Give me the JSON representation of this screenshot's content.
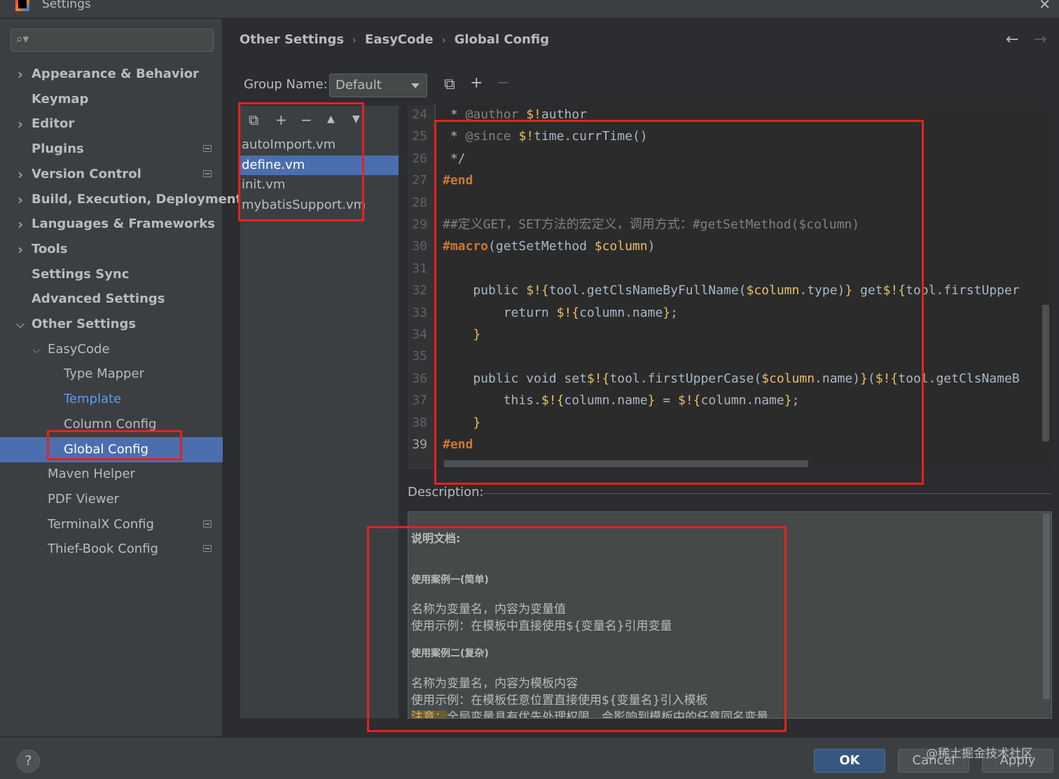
{
  "window": {
    "title": "Settings"
  },
  "search": {
    "placeholder": ""
  },
  "sidebar": {
    "items": [
      {
        "label": "Appearance & Behavior",
        "expandable": true,
        "bold": true
      },
      {
        "label": "Keymap",
        "bold": true
      },
      {
        "label": "Editor",
        "expandable": true,
        "bold": true
      },
      {
        "label": "Plugins",
        "bold": true
      },
      {
        "label": "Version Control",
        "expandable": true,
        "bold": true
      },
      {
        "label": "Build, Execution, Deployment",
        "expandable": true,
        "bold": true
      },
      {
        "label": "Languages & Frameworks",
        "expandable": true,
        "bold": true
      },
      {
        "label": "Tools",
        "expandable": true,
        "bold": true
      },
      {
        "label": "Settings Sync",
        "bold": true
      },
      {
        "label": "Advanced Settings",
        "bold": true
      },
      {
        "label": "Other Settings",
        "expanded": true,
        "bold": true
      },
      {
        "label": "EasyCode",
        "expanded": true
      },
      {
        "label": "Type Mapper"
      },
      {
        "label": "Template",
        "link": true
      },
      {
        "label": "Column Config"
      },
      {
        "label": "Global Config",
        "selected": true
      },
      {
        "label": "Maven Helper"
      },
      {
        "label": "PDF Viewer"
      },
      {
        "label": "TerminalX Config"
      },
      {
        "label": "Thief-Book Config"
      }
    ]
  },
  "breadcrumb": [
    "Other Settings",
    "EasyCode",
    "Global Config"
  ],
  "group": {
    "label": "Group Name:",
    "value": "Default"
  },
  "templates": {
    "items": [
      "autoImport.vm",
      "define.vm",
      "init.vm",
      "mybatisSupport.vm"
    ],
    "selected_index": 1
  },
  "editor": {
    "lines": [
      {
        "n": "24",
        "text": " * @author $!author"
      },
      {
        "n": "25",
        "text": " * @since $!time.currTime()"
      },
      {
        "n": "26",
        "text": " */"
      },
      {
        "n": "27",
        "text": "#end"
      },
      {
        "n": "28",
        "text": ""
      },
      {
        "n": "29",
        "text": "##定义GET，SET方法的宏定义，调用方式：#getSetMethod($column)"
      },
      {
        "n": "30",
        "text": "#macro(getSetMethod $column)"
      },
      {
        "n": "31",
        "text": ""
      },
      {
        "n": "32",
        "text": "    public $!{tool.getClsNameByFullName($column.type)} get$!{tool.firstUpper"
      },
      {
        "n": "33",
        "text": "        return $!{column.name};"
      },
      {
        "n": "34",
        "text": "    }"
      },
      {
        "n": "35",
        "text": ""
      },
      {
        "n": "36",
        "text": "    public void set$!{tool.firstUpperCase($column.name)}($!{tool.getClsNameB"
      },
      {
        "n": "37",
        "text": "        this.$!{column.name} = $!{column.name};"
      },
      {
        "n": "38",
        "text": "    }"
      },
      {
        "n": "39",
        "text": "#end"
      }
    ],
    "current_line": "39"
  },
  "description": {
    "label": "Description:",
    "heading": "说明文档:",
    "case1_title": "使用案例一(简单)",
    "case1_line1": "名称为变量名，内容为变量值",
    "case1_line2": "使用示例：在模板中直接使用${变量名}引用变量",
    "case2_title": "使用案例二(复杂)",
    "case2_line1": "名称为变量名，内容为模板内容",
    "case2_line2": "使用示例：在模板任意位置直接使用${变量名}引入模板",
    "note_label": "注意：",
    "note_text": "全局变量具有优先处理权限，会影响到模板中的任意同名变量，"
  },
  "buttons": {
    "ok": "OK",
    "cancel": "Cancel",
    "apply": "Apply",
    "help": "?"
  },
  "watermark": "@稀土掘金技术社区",
  "colors": {
    "selection": "#4b6eaf",
    "annotation": "#e3231f",
    "accent_link": "#589df6"
  }
}
